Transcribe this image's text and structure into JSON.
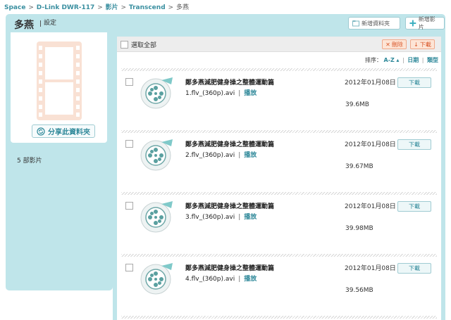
{
  "breadcrumb": {
    "items": [
      "Space",
      "D-Link DWR-117",
      "影片",
      "Transcend",
      "多燕"
    ],
    "separator": ">"
  },
  "header": {
    "title": "多燕",
    "settings_label": "設定",
    "new_folder_label": "新增資料夾",
    "new_video_label": "新增影片"
  },
  "sidebar": {
    "share_label": "分享此資料夾",
    "video_count": "5 部影片"
  },
  "toolbar": {
    "select_all_label": "選取全部",
    "delete_label": "刪除",
    "download_label": "下載"
  },
  "sort": {
    "label": "排序：",
    "options": [
      "A-Z",
      "日期",
      "類型"
    ]
  },
  "videos": [
    {
      "title": "鄭多燕減肥健身操之整體運動篇",
      "filename": "1.flv_(360p).avi",
      "play_label": "播放",
      "date": "2012年01月08日",
      "size": "39.6MB",
      "download_label": "下載"
    },
    {
      "title": "鄭多燕減肥健身操之整體運動篇",
      "filename": "2.flv_(360p).avi",
      "play_label": "播放",
      "date": "2012年01月08日",
      "size": "39.67MB",
      "download_label": "下載"
    },
    {
      "title": "鄭多燕減肥健身操之整體運動篇",
      "filename": "3.flv_(360p).avi",
      "play_label": "播放",
      "date": "2012年01月08日",
      "size": "39.98MB",
      "download_label": "下載"
    },
    {
      "title": "鄭多燕減肥健身操之整體運動篇",
      "filename": "4.flv_(360p).avi",
      "play_label": "播放",
      "date": "2012年01月08日",
      "size": "39.56MB",
      "download_label": "下載"
    }
  ],
  "colors": {
    "panel_bg": "#bfe5ea",
    "link": "#2e8899",
    "accent_orange": "#d9572a"
  }
}
